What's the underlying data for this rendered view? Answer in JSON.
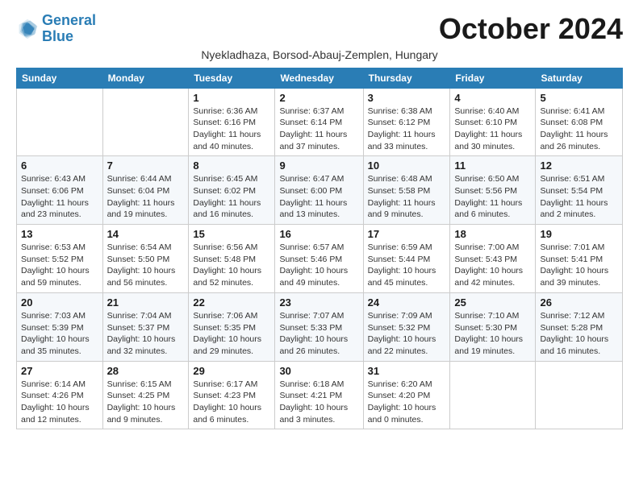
{
  "header": {
    "logo_line1": "General",
    "logo_line2": "Blue",
    "month_title": "October 2024",
    "subtitle": "Nyekladhaza, Borsod-Abauj-Zemplen, Hungary"
  },
  "days_of_week": [
    "Sunday",
    "Monday",
    "Tuesday",
    "Wednesday",
    "Thursday",
    "Friday",
    "Saturday"
  ],
  "weeks": [
    [
      {
        "day": "",
        "info": ""
      },
      {
        "day": "",
        "info": ""
      },
      {
        "day": "1",
        "sunrise": "Sunrise: 6:36 AM",
        "sunset": "Sunset: 6:16 PM",
        "daylight": "Daylight: 11 hours and 40 minutes."
      },
      {
        "day": "2",
        "sunrise": "Sunrise: 6:37 AM",
        "sunset": "Sunset: 6:14 PM",
        "daylight": "Daylight: 11 hours and 37 minutes."
      },
      {
        "day": "3",
        "sunrise": "Sunrise: 6:38 AM",
        "sunset": "Sunset: 6:12 PM",
        "daylight": "Daylight: 11 hours and 33 minutes."
      },
      {
        "day": "4",
        "sunrise": "Sunrise: 6:40 AM",
        "sunset": "Sunset: 6:10 PM",
        "daylight": "Daylight: 11 hours and 30 minutes."
      },
      {
        "day": "5",
        "sunrise": "Sunrise: 6:41 AM",
        "sunset": "Sunset: 6:08 PM",
        "daylight": "Daylight: 11 hours and 26 minutes."
      }
    ],
    [
      {
        "day": "6",
        "sunrise": "Sunrise: 6:43 AM",
        "sunset": "Sunset: 6:06 PM",
        "daylight": "Daylight: 11 hours and 23 minutes."
      },
      {
        "day": "7",
        "sunrise": "Sunrise: 6:44 AM",
        "sunset": "Sunset: 6:04 PM",
        "daylight": "Daylight: 11 hours and 19 minutes."
      },
      {
        "day": "8",
        "sunrise": "Sunrise: 6:45 AM",
        "sunset": "Sunset: 6:02 PM",
        "daylight": "Daylight: 11 hours and 16 minutes."
      },
      {
        "day": "9",
        "sunrise": "Sunrise: 6:47 AM",
        "sunset": "Sunset: 6:00 PM",
        "daylight": "Daylight: 11 hours and 13 minutes."
      },
      {
        "day": "10",
        "sunrise": "Sunrise: 6:48 AM",
        "sunset": "Sunset: 5:58 PM",
        "daylight": "Daylight: 11 hours and 9 minutes."
      },
      {
        "day": "11",
        "sunrise": "Sunrise: 6:50 AM",
        "sunset": "Sunset: 5:56 PM",
        "daylight": "Daylight: 11 hours and 6 minutes."
      },
      {
        "day": "12",
        "sunrise": "Sunrise: 6:51 AM",
        "sunset": "Sunset: 5:54 PM",
        "daylight": "Daylight: 11 hours and 2 minutes."
      }
    ],
    [
      {
        "day": "13",
        "sunrise": "Sunrise: 6:53 AM",
        "sunset": "Sunset: 5:52 PM",
        "daylight": "Daylight: 10 hours and 59 minutes."
      },
      {
        "day": "14",
        "sunrise": "Sunrise: 6:54 AM",
        "sunset": "Sunset: 5:50 PM",
        "daylight": "Daylight: 10 hours and 56 minutes."
      },
      {
        "day": "15",
        "sunrise": "Sunrise: 6:56 AM",
        "sunset": "Sunset: 5:48 PM",
        "daylight": "Daylight: 10 hours and 52 minutes."
      },
      {
        "day": "16",
        "sunrise": "Sunrise: 6:57 AM",
        "sunset": "Sunset: 5:46 PM",
        "daylight": "Daylight: 10 hours and 49 minutes."
      },
      {
        "day": "17",
        "sunrise": "Sunrise: 6:59 AM",
        "sunset": "Sunset: 5:44 PM",
        "daylight": "Daylight: 10 hours and 45 minutes."
      },
      {
        "day": "18",
        "sunrise": "Sunrise: 7:00 AM",
        "sunset": "Sunset: 5:43 PM",
        "daylight": "Daylight: 10 hours and 42 minutes."
      },
      {
        "day": "19",
        "sunrise": "Sunrise: 7:01 AM",
        "sunset": "Sunset: 5:41 PM",
        "daylight": "Daylight: 10 hours and 39 minutes."
      }
    ],
    [
      {
        "day": "20",
        "sunrise": "Sunrise: 7:03 AM",
        "sunset": "Sunset: 5:39 PM",
        "daylight": "Daylight: 10 hours and 35 minutes."
      },
      {
        "day": "21",
        "sunrise": "Sunrise: 7:04 AM",
        "sunset": "Sunset: 5:37 PM",
        "daylight": "Daylight: 10 hours and 32 minutes."
      },
      {
        "day": "22",
        "sunrise": "Sunrise: 7:06 AM",
        "sunset": "Sunset: 5:35 PM",
        "daylight": "Daylight: 10 hours and 29 minutes."
      },
      {
        "day": "23",
        "sunrise": "Sunrise: 7:07 AM",
        "sunset": "Sunset: 5:33 PM",
        "daylight": "Daylight: 10 hours and 26 minutes."
      },
      {
        "day": "24",
        "sunrise": "Sunrise: 7:09 AM",
        "sunset": "Sunset: 5:32 PM",
        "daylight": "Daylight: 10 hours and 22 minutes."
      },
      {
        "day": "25",
        "sunrise": "Sunrise: 7:10 AM",
        "sunset": "Sunset: 5:30 PM",
        "daylight": "Daylight: 10 hours and 19 minutes."
      },
      {
        "day": "26",
        "sunrise": "Sunrise: 7:12 AM",
        "sunset": "Sunset: 5:28 PM",
        "daylight": "Daylight: 10 hours and 16 minutes."
      }
    ],
    [
      {
        "day": "27",
        "sunrise": "Sunrise: 6:14 AM",
        "sunset": "Sunset: 4:26 PM",
        "daylight": "Daylight: 10 hours and 12 minutes."
      },
      {
        "day": "28",
        "sunrise": "Sunrise: 6:15 AM",
        "sunset": "Sunset: 4:25 PM",
        "daylight": "Daylight: 10 hours and 9 minutes."
      },
      {
        "day": "29",
        "sunrise": "Sunrise: 6:17 AM",
        "sunset": "Sunset: 4:23 PM",
        "daylight": "Daylight: 10 hours and 6 minutes."
      },
      {
        "day": "30",
        "sunrise": "Sunrise: 6:18 AM",
        "sunset": "Sunset: 4:21 PM",
        "daylight": "Daylight: 10 hours and 3 minutes."
      },
      {
        "day": "31",
        "sunrise": "Sunrise: 6:20 AM",
        "sunset": "Sunset: 4:20 PM",
        "daylight": "Daylight: 10 hours and 0 minutes."
      },
      {
        "day": "",
        "info": ""
      },
      {
        "day": "",
        "info": ""
      }
    ]
  ]
}
